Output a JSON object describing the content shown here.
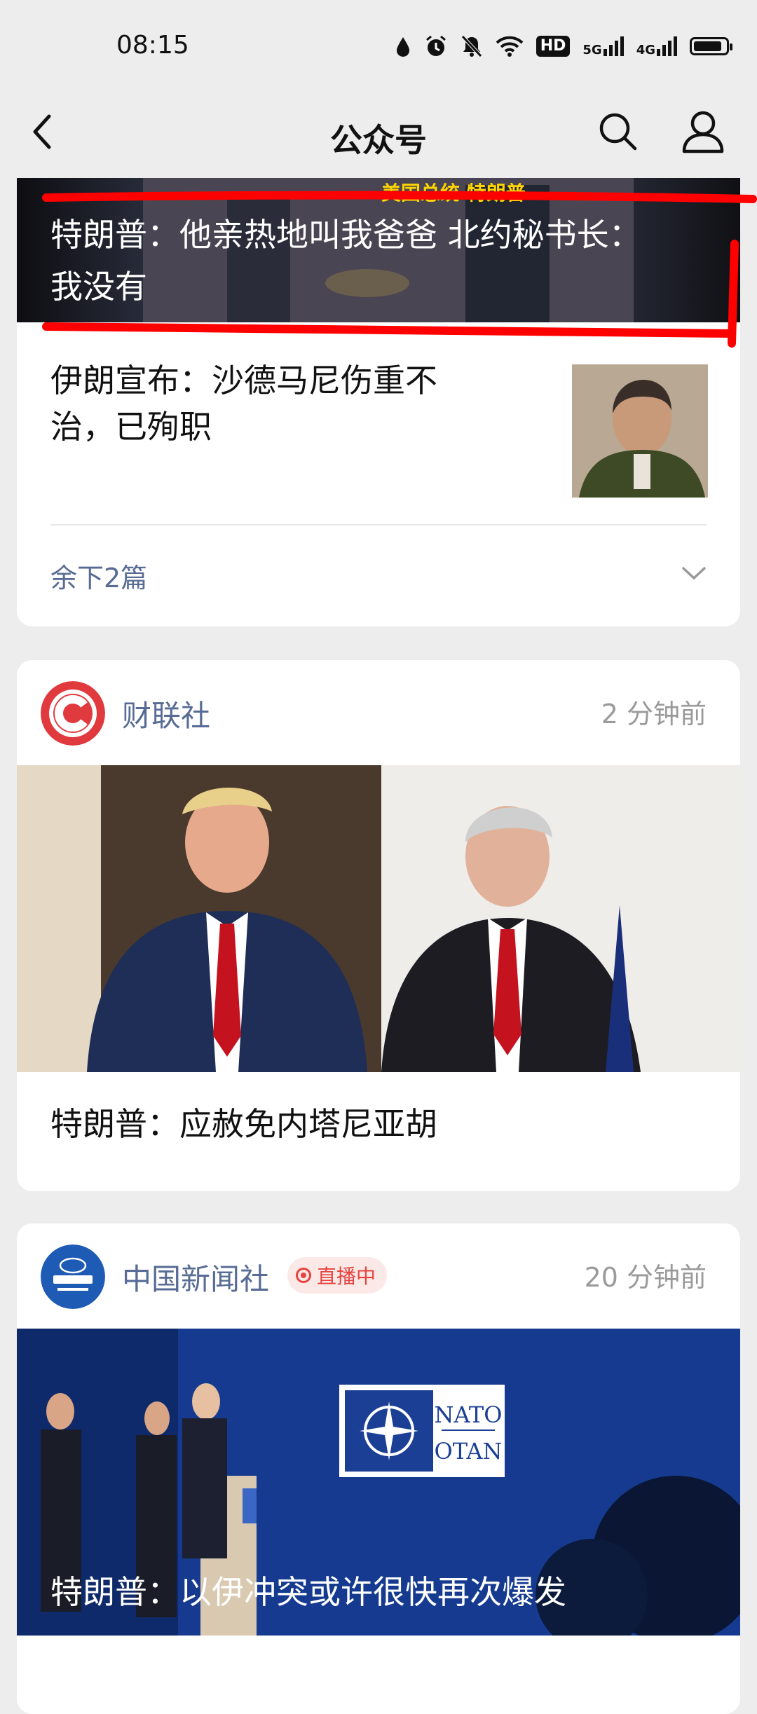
{
  "status_bar": {
    "time": "08:15",
    "icons": [
      "water-drop-icon",
      "alarm-icon",
      "mute-icon",
      "wifi-icon",
      "hd-icon",
      "5g-signal-icon",
      "4g-signal-icon",
      "battery-icon"
    ],
    "hd_label": "HD",
    "net1": "5G",
    "net2": "4G"
  },
  "nav": {
    "title": "公众号",
    "back_icon": "chevron-left-icon",
    "search_icon": "search-icon",
    "user_icon": "user-icon"
  },
  "card1": {
    "banner_text": "美国总统 特朗普",
    "hero_title": "特朗普：他亲热地叫我爸爸 北约秘书长：我没有",
    "article_title": "伊朗宣布：沙德马尼伤重不治，已殉职",
    "more_label": "余下2篇"
  },
  "card2": {
    "source": "财联社",
    "time": "2 分钟前",
    "title": "特朗普：应赦免内塔尼亚胡"
  },
  "card3": {
    "source": "中国新闻社",
    "live_label": "直播中",
    "time": "20 分钟前",
    "nato_line1": "NATO",
    "nato_line2": "OTAN",
    "title": "特朗普：以伊冲突或许很快再次爆发"
  },
  "colors": {
    "background": "#ededed",
    "link_blue": "#576b95",
    "live_red": "#e64340",
    "annotation_red": "#ff0000"
  }
}
